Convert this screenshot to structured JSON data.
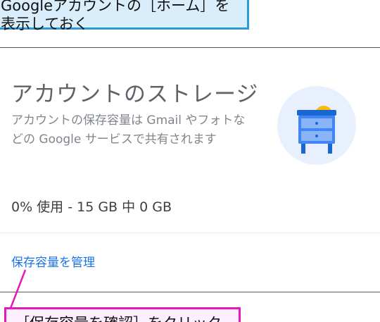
{
  "callout_top": {
    "line1": "Googleアカウントの［ホーム］を",
    "line2": "表示しておく"
  },
  "card": {
    "title": "アカウントのストレージ",
    "description": "アカウントの保存容量は Gmail やフォトなどの Google サービスで共有されます",
    "usage": "0% 使用 - 15 GB 中 0 GB",
    "manage_link": "保存容量を管理"
  },
  "callout_bottom": {
    "text": "［保存容量を確認］をクリック"
  },
  "colors": {
    "top_callout_border": "#2a9ad8",
    "top_callout_fill": "#d9eefa",
    "bottom_callout_border": "#e619b8",
    "link": "#1a73e8",
    "illustration_bg": "#e8f0fe",
    "cabinet": "#1a73e8"
  },
  "icons": {
    "illustration": "storage-cabinet-icon"
  }
}
